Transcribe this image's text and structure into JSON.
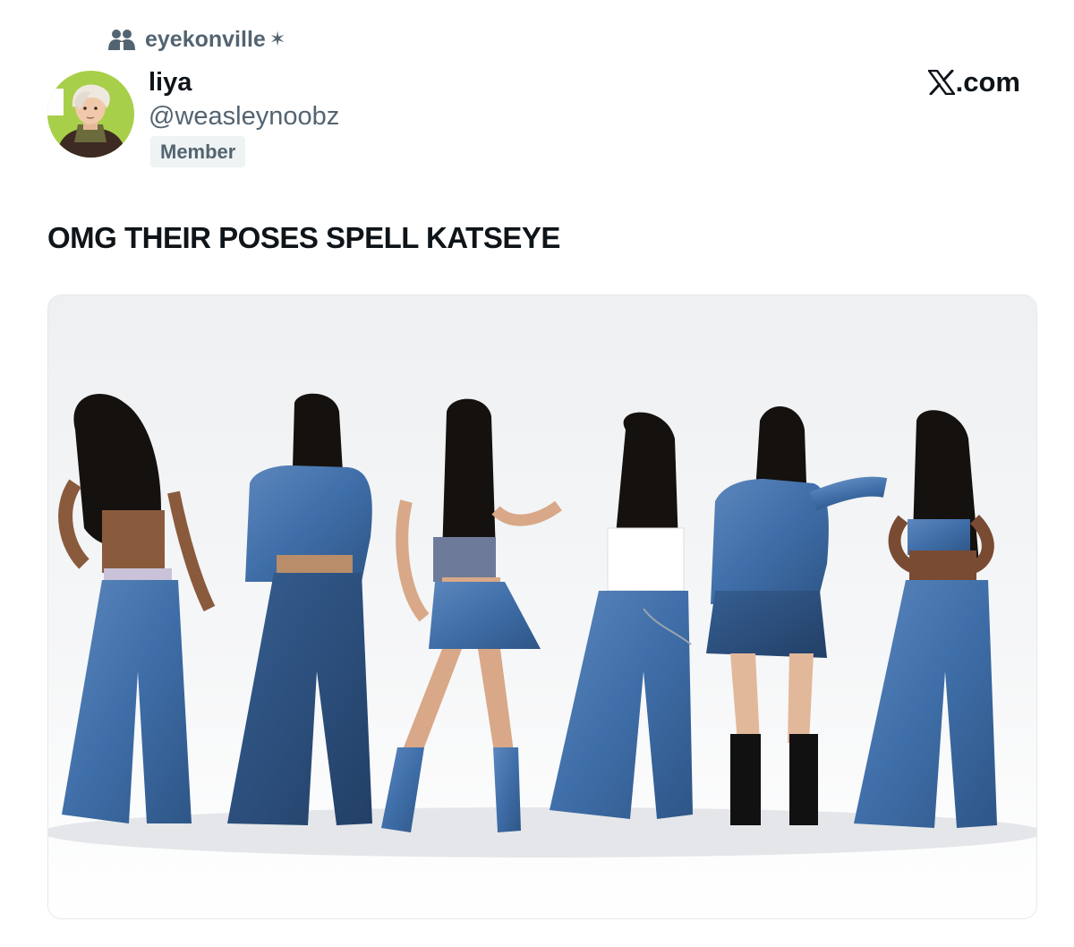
{
  "community": {
    "name": "eyekonville",
    "icon": "people-icon",
    "marker": "✶"
  },
  "author": {
    "display_name": "liya",
    "handle": "@weasleynoobz",
    "role_badge": "Member",
    "avatar": "avatar-illustration"
  },
  "brand": {
    "logo": "x-logo-icon",
    "suffix": ".com"
  },
  "post": {
    "text": "OMG THEIR POSES SPELL KATSEYE",
    "media": {
      "type": "photo",
      "subject_count": 6
    }
  },
  "colors": {
    "text_primary": "#0f1419",
    "text_secondary": "#536471",
    "badge_bg": "#eff3f4",
    "denim": "#3f6ea8",
    "hair": "#15110f"
  }
}
